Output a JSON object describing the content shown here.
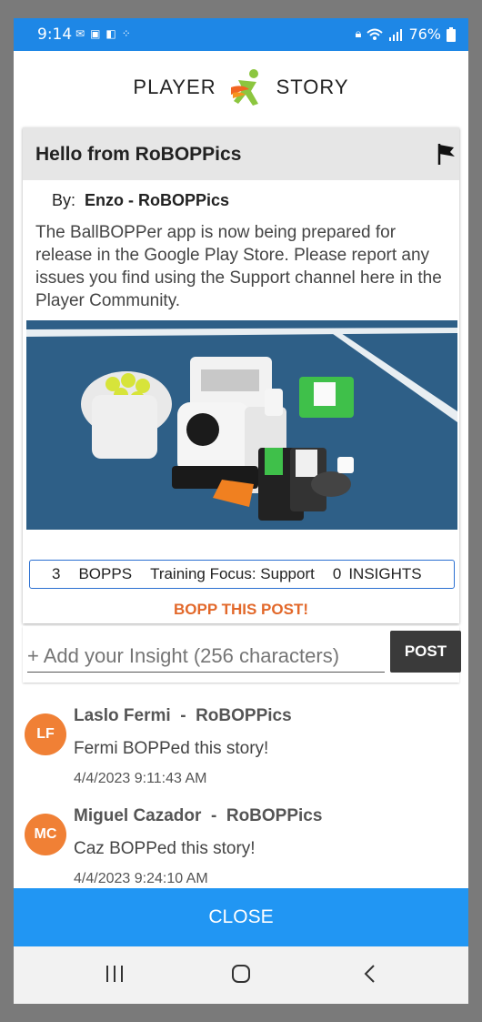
{
  "status_bar": {
    "time": "9:14",
    "left_icons": [
      "mail-icon",
      "ap-icon",
      "outlook-icon",
      "dots-icon"
    ],
    "battery": "76%",
    "right_icons": [
      "lock-icon",
      "wifi-icon",
      "signal-icon",
      "battery-icon"
    ]
  },
  "header": {
    "logo_left": "PLAYER",
    "logo_right": "STORY"
  },
  "post": {
    "title": "Hello from RoBOPPics",
    "by_label": "By:",
    "author": "Enzo - RoBOPPics",
    "body": "The BallBOPPer app is now being prepared for release in the Google Play Store. Please report any issues you find using the Support channel here in the Player Community.",
    "image_alt": "BallBOPPer robot on tennis court",
    "bopps_count": "3",
    "bopps_label": "BOPPS",
    "training_focus": "Training Focus: Support",
    "insights_count": "0",
    "insights_label": "INSIGHTS",
    "bopp_action": "BOPP THIS POST!"
  },
  "insight": {
    "placeholder": "+ Add your Insight (256 characters)",
    "post_label": "POST"
  },
  "comments": [
    {
      "initials": "LF",
      "name": "Laslo Fermi  -  RoBOPPics",
      "text": "Fermi BOPPed this story!",
      "time": "4/4/2023 9:11:43 AM"
    },
    {
      "initials": "MC",
      "name": "Miguel Cazador  -  RoBOPPics",
      "text": "Caz BOPPed this story!",
      "time": "4/4/2023 9:24:10 AM"
    }
  ],
  "close_label": "CLOSE",
  "colors": {
    "accent": "#2196f3",
    "orange": "#e2682a",
    "avatar": "#f08035"
  }
}
